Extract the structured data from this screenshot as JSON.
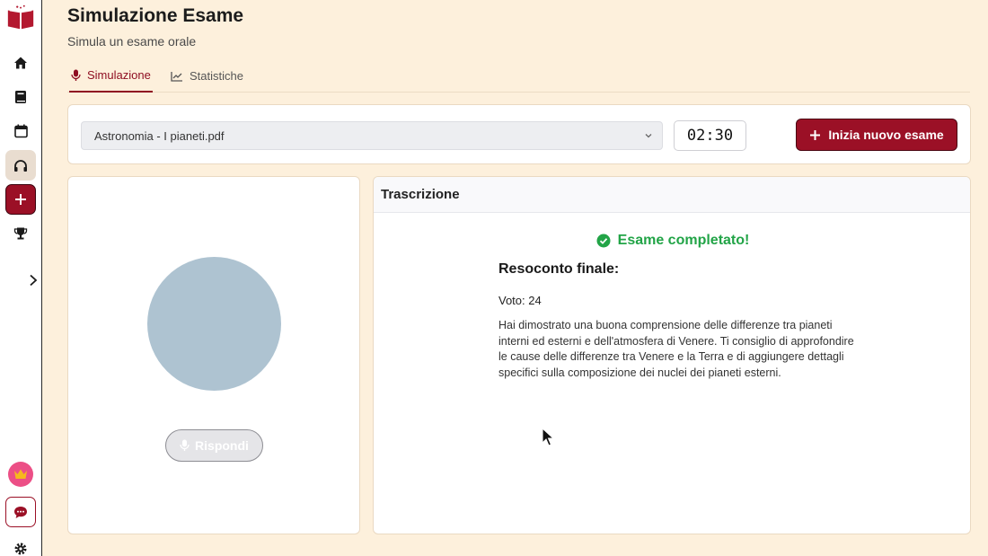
{
  "app": {
    "title": "Simulazione Esame",
    "subtitle": "Simula un esame orale"
  },
  "sidebar": {
    "items": [
      {
        "icon": "logo-book-icon"
      },
      {
        "icon": "home-icon"
      },
      {
        "icon": "book-icon"
      },
      {
        "icon": "calendar-icon"
      },
      {
        "icon": "headphones-icon",
        "active": true
      },
      {
        "icon": "plus-icon"
      },
      {
        "icon": "trophy-icon"
      },
      {
        "icon": "chevron-right-icon"
      },
      {
        "icon": "crown-icon"
      },
      {
        "icon": "chat-icon"
      },
      {
        "icon": "gear-icon"
      }
    ]
  },
  "tabs": [
    {
      "label": "Simulazione",
      "icon": "mic-icon",
      "active": true
    },
    {
      "label": "Statistiche",
      "icon": "chart-line-icon",
      "active": false
    }
  ],
  "controls": {
    "document_select": "Astronomia - I pianeti.pdf",
    "timer": "02:30",
    "start_button": "Inizia nuovo esame"
  },
  "left_panel": {
    "respond_button": "Rispondi"
  },
  "transcript": {
    "header": "Trascrizione",
    "status": "Esame completato!",
    "summary_title": "Resoconto finale:",
    "grade": "Voto: 24",
    "feedback": "Hai dimostrato una buona comprensione delle differenze tra pianeti interni ed esterni e dell'atmosfera di Venere. Ti consiglio di approfondire le cause delle differenze tra Venere e la Terra e di aggiungere dettagli specifici sulla composizione dei nuclei dei pianeti esterni."
  },
  "colors": {
    "brand": "#9b1026",
    "background": "#fdf0dc",
    "success": "#22a447",
    "avatar": "#aec3d1"
  }
}
